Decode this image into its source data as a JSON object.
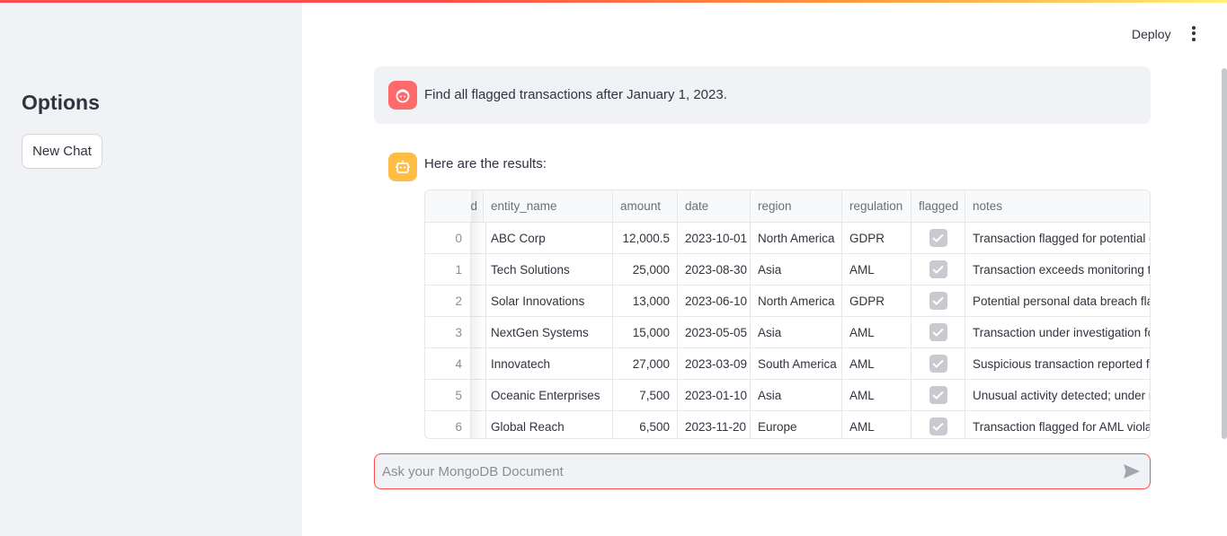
{
  "sidebar": {
    "title": "Options",
    "new_chat_label": "New Chat"
  },
  "header": {
    "deploy_label": "Deploy",
    "menu_icon": "kebab-menu-icon"
  },
  "messages": {
    "user": {
      "avatar_icon": "user-face-icon",
      "text": "Find all flagged transactions after January 1, 2023."
    },
    "assistant": {
      "avatar_icon": "robot-icon",
      "text": "Here are the results:"
    }
  },
  "table": {
    "columns": [
      "_id",
      "entity_name",
      "amount",
      "date",
      "region",
      "regulation",
      "flagged",
      "notes"
    ],
    "visible_first_column_fragment": "d",
    "rows": [
      {
        "index": "0",
        "entity_name": "ABC Corp",
        "amount": "12,000.5",
        "date": "2023-10-01",
        "region": "North America",
        "regulation": "GDPR",
        "flagged": true,
        "notes": "Transaction flagged for potential c"
      },
      {
        "index": "1",
        "entity_name": "Tech Solutions",
        "amount": "25,000",
        "date": "2023-08-30",
        "region": "Asia",
        "regulation": "AML",
        "flagged": true,
        "notes": "Transaction exceeds monitoring th"
      },
      {
        "index": "2",
        "entity_name": "Solar Innovations",
        "amount": "13,000",
        "date": "2023-06-10",
        "region": "North America",
        "regulation": "GDPR",
        "flagged": true,
        "notes": "Potential personal data breach fla"
      },
      {
        "index": "3",
        "entity_name": "NextGen Systems",
        "amount": "15,000",
        "date": "2023-05-05",
        "region": "Asia",
        "regulation": "AML",
        "flagged": true,
        "notes": "Transaction under investigation fo"
      },
      {
        "index": "4",
        "entity_name": "Innovatech",
        "amount": "27,000",
        "date": "2023-03-09",
        "region": "South America",
        "regulation": "AML",
        "flagged": true,
        "notes": "Suspicious transaction reported fo"
      },
      {
        "index": "5",
        "entity_name": "Oceanic Enterprises",
        "amount": "7,500",
        "date": "2023-01-10",
        "region": "Asia",
        "regulation": "AML",
        "flagged": true,
        "notes": "Unusual activity detected; under r"
      },
      {
        "index": "6",
        "entity_name": "Global Reach",
        "amount": "6,500",
        "date": "2023-11-20",
        "region": "Europe",
        "regulation": "AML",
        "flagged": true,
        "notes": "Transaction flagged for AML violat"
      }
    ]
  },
  "chat_input": {
    "placeholder": "Ask your MongoDB Document",
    "value": "",
    "send_icon": "send-icon"
  },
  "colors": {
    "accent": "#ff4b4b",
    "sidebar_bg": "#f0f2f6",
    "user_avatar": "#ff6b6b",
    "bot_avatar": "#ffbd45"
  }
}
